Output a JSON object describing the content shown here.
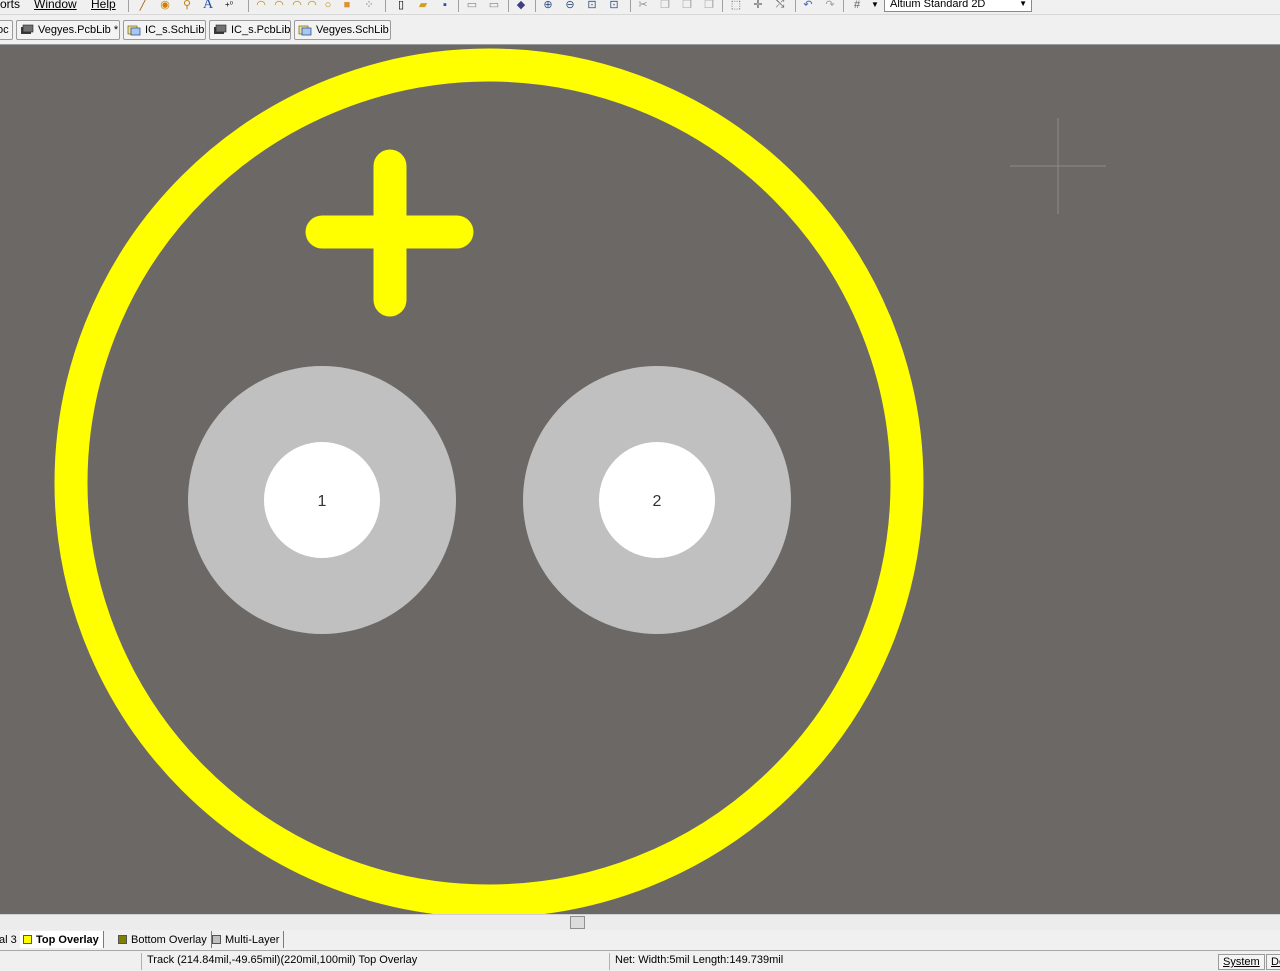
{
  "menu": {
    "items": [
      {
        "label": "orts"
      },
      {
        "label": "Window"
      },
      {
        "label": "Help"
      }
    ]
  },
  "toolbar": {
    "view_mode": "Altium Standard 2D"
  },
  "doc_tabs": [
    {
      "label": "oc"
    },
    {
      "label": "Vegyes.PcbLib *"
    },
    {
      "label": "IC_s.SchLib"
    },
    {
      "label": "IC_s.PcbLib"
    },
    {
      "label": "Vegyes.SchLib"
    }
  ],
  "canvas": {
    "background": "#6c6866",
    "overlay_color": "#ffff00",
    "pads": [
      {
        "designator": "1"
      },
      {
        "designator": "2"
      }
    ]
  },
  "layer_tabs": [
    {
      "label": "al 3",
      "color": "#c0c0c0"
    },
    {
      "label": "Top Overlay",
      "color": "#ffff00"
    },
    {
      "label": "Bottom Overlay",
      "color": "#808000"
    },
    {
      "label": "Multi-Layer",
      "color": "#c0c0c0"
    }
  ],
  "status": {
    "left": "Track (214.84mil,-49.65mil)(220mil,100mil)  Top Overlay",
    "right": "Net: Width:5mil Length:149.739mil",
    "system_button": "System",
    "edge_button": "De"
  }
}
